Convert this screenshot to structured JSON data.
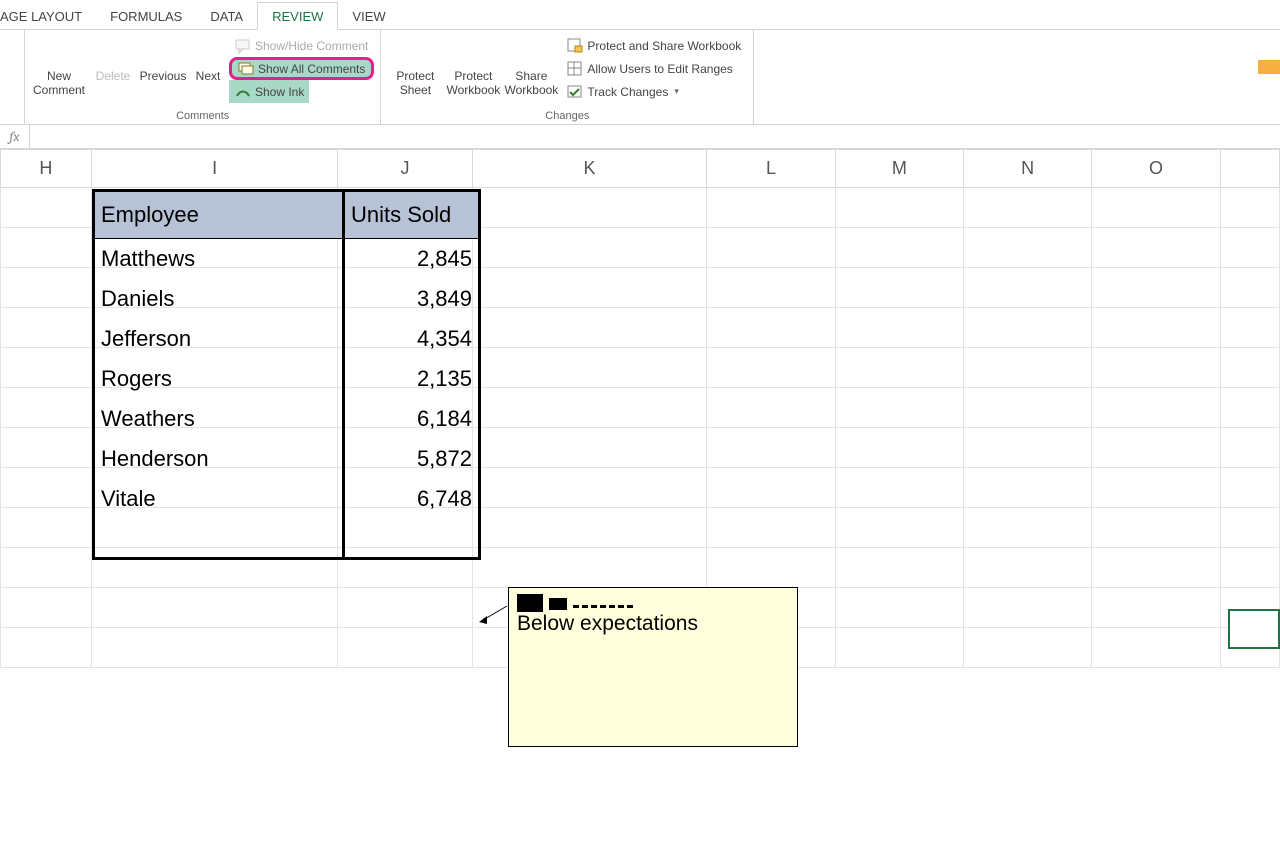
{
  "tabs": {
    "page_layout": "AGE LAYOUT",
    "formulas": "FORMULAS",
    "data": "DATA",
    "review": "REVIEW",
    "view": "VIEW"
  },
  "ribbon": {
    "comments_group": {
      "new_comment": "New Comment",
      "delete": "Delete",
      "previous": "Previous",
      "next": "Next",
      "show_hide": "Show/Hide Comment",
      "show_all": "Show All Comments",
      "show_ink": "Show Ink",
      "label": "Comments"
    },
    "changes_group": {
      "protect_sheet": "Protect Sheet",
      "protect_workbook": "Protect Workbook",
      "share_workbook": "Share Workbook",
      "protect_share": "Protect and Share Workbook",
      "allow_users": "Allow Users to Edit Ranges",
      "track_changes": "Track Changes",
      "label": "Changes"
    }
  },
  "formula_bar": {
    "fx": "fx",
    "value": ""
  },
  "columns": [
    "H",
    "I",
    "J",
    "K",
    "L",
    "M",
    "N",
    "O"
  ],
  "data_table": {
    "headers": {
      "employee": "Employee",
      "units": "Units Sold"
    },
    "rows": [
      {
        "name": "Matthews",
        "units": "2,845"
      },
      {
        "name": "Daniels",
        "units": "3,849"
      },
      {
        "name": "Jefferson",
        "units": "4,354"
      },
      {
        "name": "Rogers",
        "units": "2,135"
      },
      {
        "name": "Weathers",
        "units": "6,184"
      },
      {
        "name": "Henderson",
        "units": "5,872"
      },
      {
        "name": "Vitale",
        "units": "6,748"
      }
    ]
  },
  "comment": {
    "text": "Below expectations"
  }
}
